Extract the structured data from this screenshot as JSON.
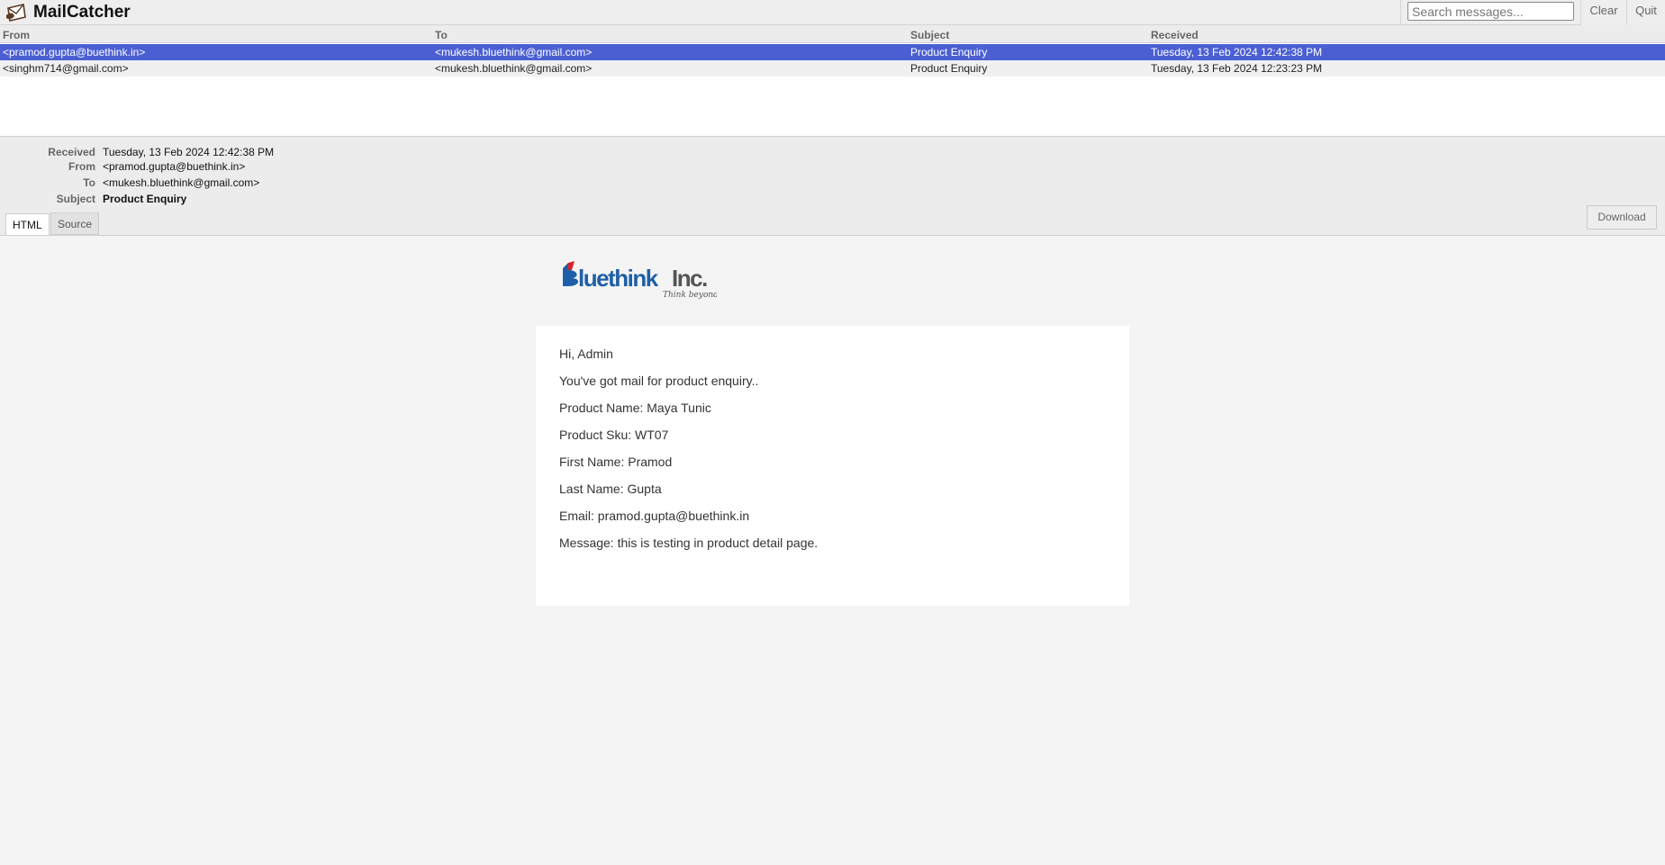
{
  "app": {
    "title": "MailCatcher",
    "search_placeholder": "Search messages...",
    "clear_label": "Clear",
    "quit_label": "Quit"
  },
  "list": {
    "columns": [
      "From",
      "To",
      "Subject",
      "Received"
    ],
    "rows": [
      {
        "from": "<pramod.gupta@buethink.in>",
        "to": "<mukesh.bluethink@gmail.com>",
        "subject": "Product Enquiry",
        "received": "Tuesday, 13 Feb 2024 12:42:38 PM",
        "selected": true
      },
      {
        "from": "<singhm714@gmail.com>",
        "to": "<mukesh.bluethink@gmail.com>",
        "subject": "Product Enquiry",
        "received": "Tuesday, 13 Feb 2024 12:23:23 PM",
        "selected": false
      }
    ]
  },
  "message": {
    "labels": {
      "received": "Received",
      "from": "From",
      "to": "To",
      "subject": "Subject"
    },
    "received": "Tuesday, 13 Feb 2024 12:42:38 PM",
    "from": "<pramod.gupta@buethink.in>",
    "to": "<mukesh.bluethink@gmail.com>",
    "subject": "Product Enquiry",
    "tabs": [
      "HTML",
      "Source"
    ],
    "active_tab": "HTML",
    "download_label": "Download"
  },
  "email": {
    "logo": {
      "text_blue": "luethink",
      "text_gray": "Inc.",
      "tagline": "Think beyond"
    },
    "lines": [
      "Hi, Admin",
      "You've got mail for product enquiry..",
      "Product Name: Maya Tunic",
      "Product Sku: WT07",
      "First Name: Pramod",
      "Last Name: Gupta",
      "Email: pramod.gupta@buethink.in",
      "Message: this is testing in product detail page."
    ]
  },
  "colors": {
    "selected_row": "#4b5fd3",
    "logo_blue": "#1f5fa8",
    "logo_red": "#d8232a"
  }
}
